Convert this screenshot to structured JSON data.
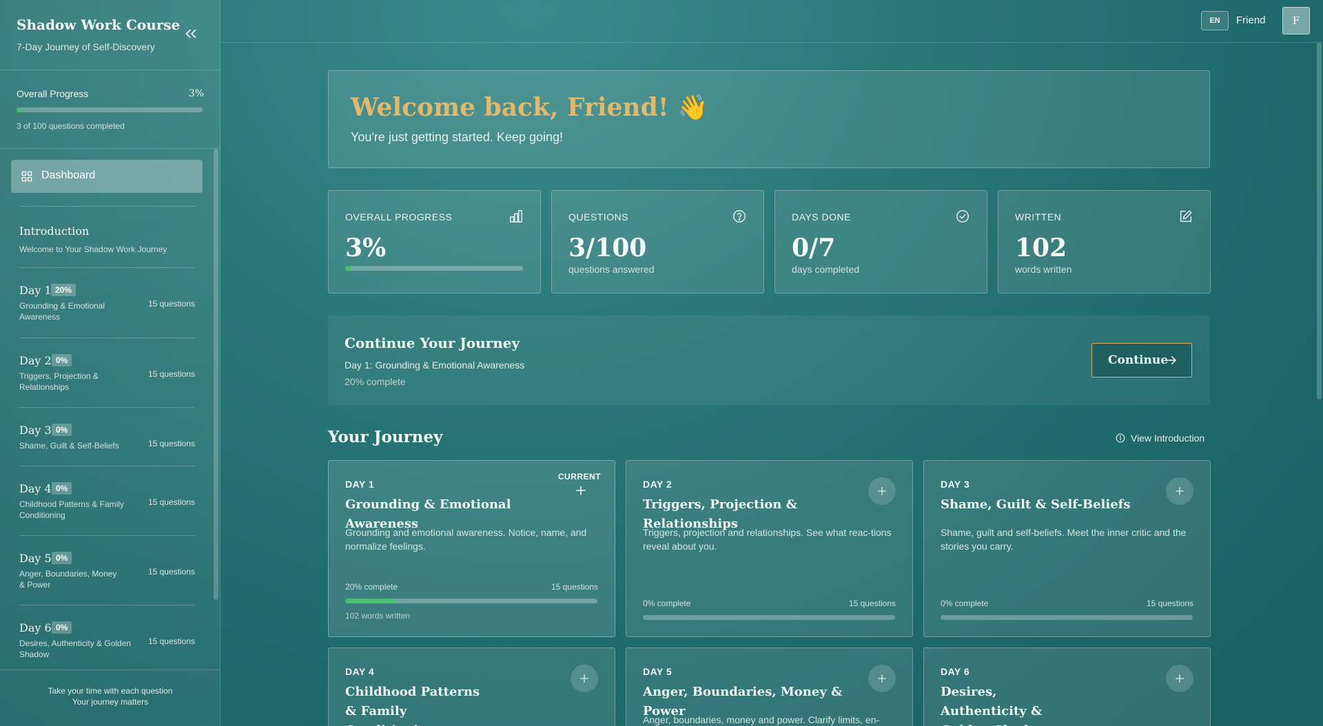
{
  "sidebar": {
    "title": "Shadow Work Course",
    "subtitle": "7-Day Journey of Self-Discovery",
    "progress": {
      "label": "Overall Progress",
      "value": "3%",
      "fraction": 0.03,
      "count": "3 of 100 questions completed"
    },
    "dashboard_label": "Dashboard",
    "intro": {
      "title": "Introduction",
      "subtitle": "Welcome to Your Shadow Work Journey"
    },
    "days": [
      {
        "name": "Day 1",
        "badge": "20%",
        "desc": "Grounding & Emotional Awareness",
        "questions": "15 questions"
      },
      {
        "name": "Day 2",
        "badge": "0%",
        "desc": "Triggers, Projection & Relationships",
        "questions": "15 questions"
      },
      {
        "name": "Day 3",
        "badge": "0%",
        "desc": "Shame, Guilt & Self-Beliefs",
        "questions": "15 questions"
      },
      {
        "name": "Day 4",
        "badge": "0%",
        "desc": "Childhood Patterns & Family Conditioning",
        "questions": "15 questions"
      },
      {
        "name": "Day 5",
        "badge": "0%",
        "desc": "Anger, Boundaries, Money & Power",
        "questions": "15 questions"
      },
      {
        "name": "Day 6",
        "badge": "0%",
        "desc": "Desires, Authenticity & Golden Shadow",
        "questions": "15 questions"
      }
    ],
    "footer": {
      "line1": "Take your time with each question",
      "line2": "Your journey matters"
    }
  },
  "topbar": {
    "language": "EN",
    "user_name": "Friend",
    "avatar_initial": "F"
  },
  "welcome": {
    "title": "Welcome back, Friend! 👋",
    "subtitle": "You're just getting started. Keep going!"
  },
  "stats": [
    {
      "label": "OVERALL PROGRESS",
      "value": "3%",
      "fraction": 0.03,
      "icon": "bar-chart-icon"
    },
    {
      "label": "QUESTIONS",
      "value": "3/100",
      "sub": "questions answered",
      "icon": "help-circle-icon"
    },
    {
      "label": "DAYS DONE",
      "value": "0/7",
      "sub": "days completed",
      "icon": "check-circle-icon"
    },
    {
      "label": "WRITTEN",
      "value": "102",
      "sub": "words written",
      "icon": "edit-icon"
    }
  ],
  "continue": {
    "title": "Continue Your Journey",
    "day": "Day 1: Grounding & Emotional Awareness",
    "percent": "20% complete",
    "button_label": "Continue"
  },
  "journey": {
    "title": "Your Journey",
    "view_intro_label": "View Introduction",
    "current_label": "CURRENT",
    "cards": [
      {
        "day": "DAY 1",
        "title": "Grounding & Emotional Awareness",
        "desc": "Grounding and emotional awareness. Notice, name, and normalize feelings.",
        "percent": "20% complete",
        "fraction": 0.2,
        "questions": "15 questions",
        "words": "102 words written"
      },
      {
        "day": "DAY 2",
        "title": "Triggers, Projection & Relationships",
        "desc": "Triggers, projection and relationships. See what reac-tions reveal about you.",
        "percent": "0% complete",
        "fraction": 0,
        "questions": "15 questions"
      },
      {
        "day": "DAY 3",
        "title": "Shame, Guilt & Self-Beliefs",
        "desc": "Shame, guilt and self-beliefs. Meet the inner critic and the stories you carry.",
        "percent": "0% complete",
        "fraction": 0,
        "questions": "15 questions"
      },
      {
        "day": "DAY 4",
        "title": "Childhood Patterns & Family Conditioning"
      },
      {
        "day": "DAY 5",
        "title": "Anger, Boundaries, Money & Power",
        "desc": "Anger, boundaries, money and power. Clarify limits, en-"
      },
      {
        "day": "DAY 6",
        "title": "Desires, Authenticity & Golden Shadow"
      }
    ]
  },
  "colors": {
    "accent_gold": "#e2b96a",
    "progress_green": "#48c16a",
    "background_teal": "#2a7778"
  }
}
